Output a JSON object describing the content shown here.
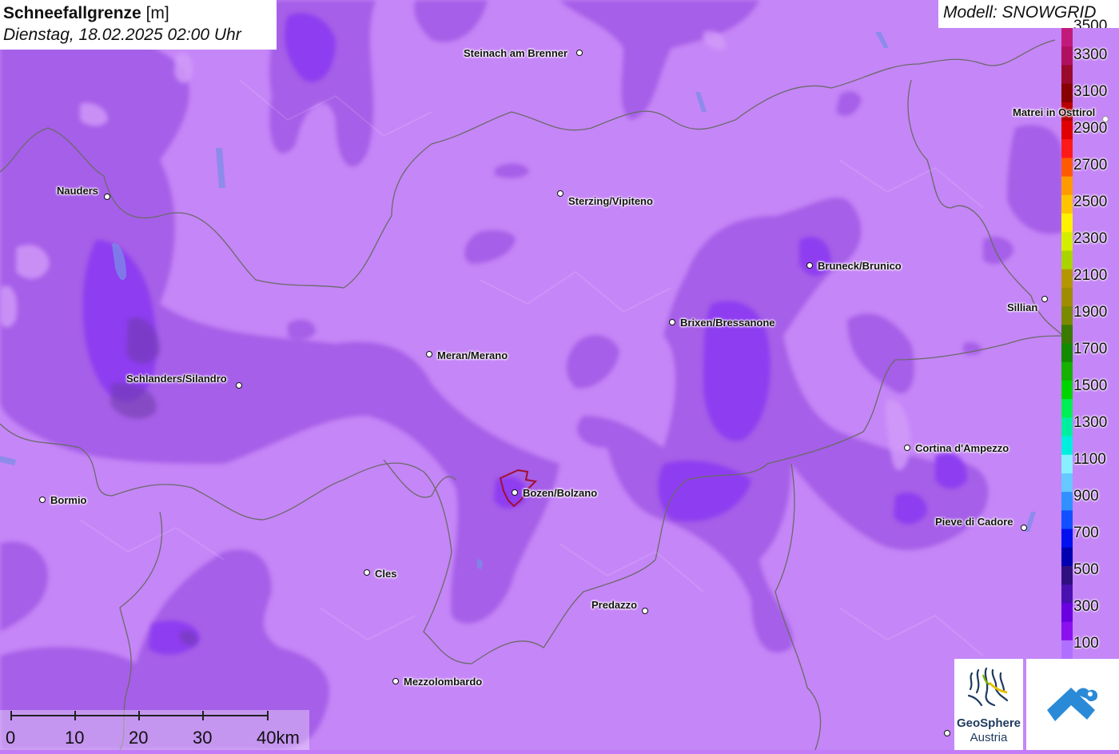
{
  "title": {
    "parameter": "Schneefallgrenze",
    "unit": "[m]",
    "datetime": "Dienstag, 18.02.2025 02:00 Uhr"
  },
  "model": "Modell: SNOWGRID",
  "legend": {
    "top_label": "3500",
    "labels": [
      "3300",
      "3100",
      "2900",
      "2700",
      "2500",
      "2300",
      "2100",
      "1900",
      "1700",
      "1500",
      "1300",
      "1100",
      "900",
      "700",
      "500",
      "300",
      "100"
    ],
    "colors": [
      "#c21a7a",
      "#b0105e",
      "#9a0a2c",
      "#880000",
      "#b80000",
      "#e00000",
      "#ff1a1a",
      "#ff5a00",
      "#ff9a00",
      "#ffc400",
      "#fff200",
      "#d4ee00",
      "#aad400",
      "#b49600",
      "#a08c00",
      "#7a8a00",
      "#3a7a00",
      "#138a00",
      "#15b000",
      "#00d400",
      "#00ee55",
      "#00eea0",
      "#00eede",
      "#88f0ff",
      "#66c8ff",
      "#3090ff",
      "#1050ff",
      "#0010ee",
      "#0000b0",
      "#301080",
      "#4a10b0",
      "#6a00e0",
      "#8a10ee",
      "#b070ff"
    ]
  },
  "cities": [
    {
      "name": "Steinach am Brenner"
    },
    {
      "name": "Nauders"
    },
    {
      "name": "Sterzing/Vipiteno"
    },
    {
      "name": "Matrei in Osttirol"
    },
    {
      "name": "Bruneck/Brunico"
    },
    {
      "name": "Sillian"
    },
    {
      "name": "Brixen/Bressanone"
    },
    {
      "name": "Meran/Merano"
    },
    {
      "name": "Schlanders/Silandro"
    },
    {
      "name": "Cortina d'Ampezzo"
    },
    {
      "name": "Bormio"
    },
    {
      "name": "Bozen/Bolzano"
    },
    {
      "name": "Pieve di Cadore"
    },
    {
      "name": "Cles"
    },
    {
      "name": "Predazzo"
    },
    {
      "name": "Mezzolombardo"
    }
  ],
  "scale": {
    "labels": [
      "0",
      "10",
      "20",
      "30",
      "40km"
    ]
  },
  "logos": {
    "geosphere_line1": "GeoSphere",
    "geosphere_line2": "Austria"
  }
}
